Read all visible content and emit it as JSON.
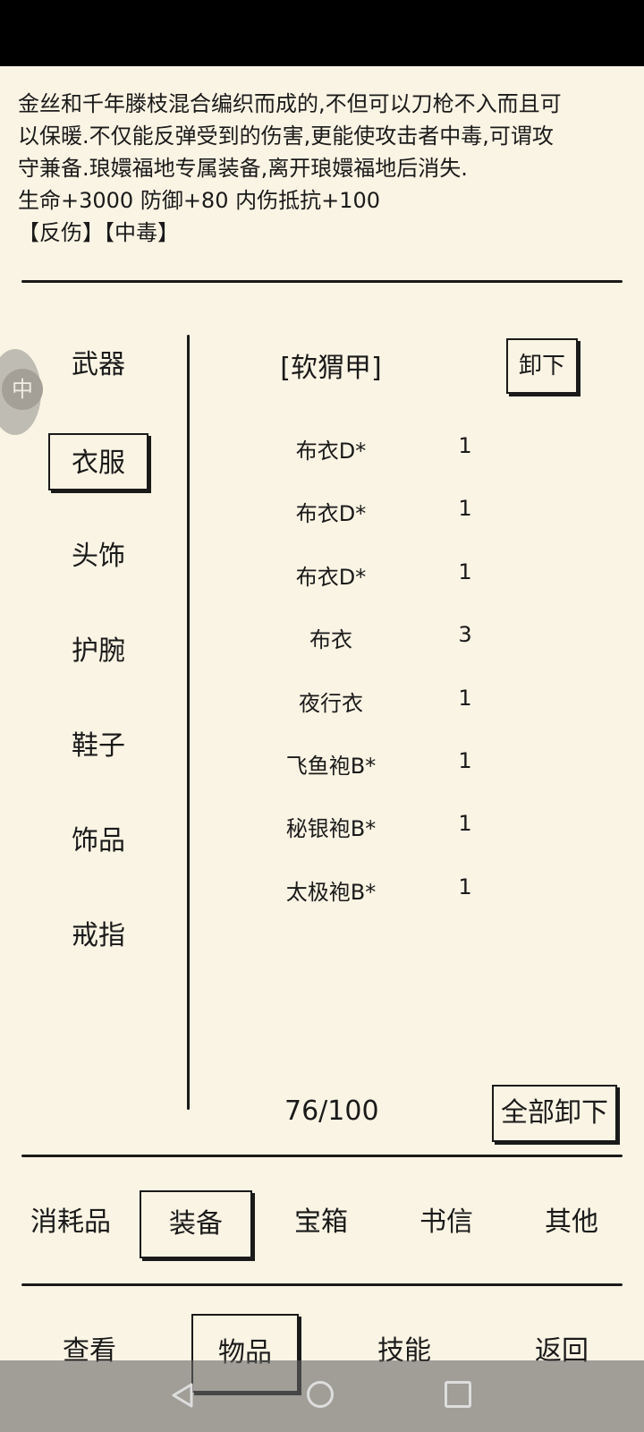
{
  "description": {
    "lines": [
      "金丝和千年滕枝混合编织而成的,不但可以刀枪不入而且可",
      "以保暖.不仅能反弹受到的伤害,更能使攻击者中毒,可谓攻",
      "守兼备.琅嬛福地专属装备,离开琅嬛福地后消失.",
      "生命+3000 防御+80 内伤抵抗+100",
      "【反伤】【中毒】"
    ]
  },
  "float_button": {
    "icon": "float-menu-icon",
    "glyph": "中"
  },
  "categories": [
    "武器",
    "衣服",
    "头饰",
    "护腕",
    "鞋子",
    "饰品",
    "戒指"
  ],
  "selected_category": "衣服",
  "equipped_item": "[软猬甲]",
  "unequip_label": "卸下",
  "items": [
    {
      "name": "布衣D*",
      "qty": "1"
    },
    {
      "name": "布衣D*",
      "qty": "1"
    },
    {
      "name": "布衣D*",
      "qty": "1"
    },
    {
      "name": "布衣",
      "qty": "3"
    },
    {
      "name": "夜行衣",
      "qty": "1"
    },
    {
      "name": "飞鱼袍B*",
      "qty": "1"
    },
    {
      "name": "秘银袍B*",
      "qty": "1"
    },
    {
      "name": "太极袍B*",
      "qty": "1"
    }
  ],
  "capacity": "76/100",
  "unequip_all_label": "全部卸下",
  "tabs": [
    "消耗品",
    "装备",
    "宝箱",
    "书信",
    "其他"
  ],
  "selected_tab": "装备",
  "nav": [
    "查看",
    "物品",
    "技能",
    "返回"
  ],
  "selected_nav": "物品",
  "system_nav": {
    "back_icon": "back-triangle-icon",
    "home_icon": "home-circle-icon",
    "recent_icon": "recent-square-icon"
  }
}
